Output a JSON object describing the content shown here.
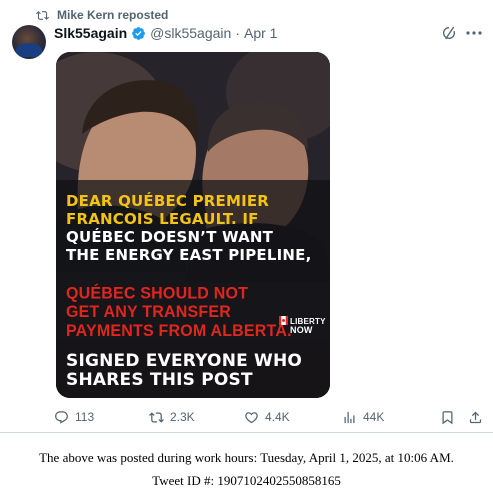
{
  "repost": {
    "text": "Mike Kern reposted",
    "icon": "repost-icon"
  },
  "author": {
    "name": "Slk55again",
    "handle": "@slk55again",
    "separator": "·",
    "date": "Apr 1",
    "verified": true,
    "verified_color": "#1d9bf0"
  },
  "image": {
    "yellow_lines": [
      "DEAR QUÉBEC PREMIER",
      "FRANCOIS LEGAULT. IF"
    ],
    "white_lines": [
      "QUÉBEC DOESN’T WANT",
      "THE ENERGY EAST PIPELINE,"
    ],
    "red_lines": [
      "QUÉBEC SHOULD NOT",
      "GET ANY TRANSFER",
      "PAYMENTS FROM ALBERTA."
    ],
    "bottom_lines": [
      "SIGNED EVERYONE WHO",
      "SHARES THIS POST"
    ],
    "logo": {
      "line1": "LIBERTY",
      "line2": "NOW"
    },
    "colors": {
      "yellow": "#f3c315",
      "red": "#e0261f",
      "white": "#ffffff"
    }
  },
  "actions": {
    "replies": "113",
    "reposts": "2.3K",
    "likes": "4.4K",
    "views": "44K"
  },
  "caption": {
    "line1": "The above was posted during work hours: Tuesday, April 1, 2025, at 10:06 AM.",
    "line2": "Tweet ID #: 1907102402550858165"
  }
}
